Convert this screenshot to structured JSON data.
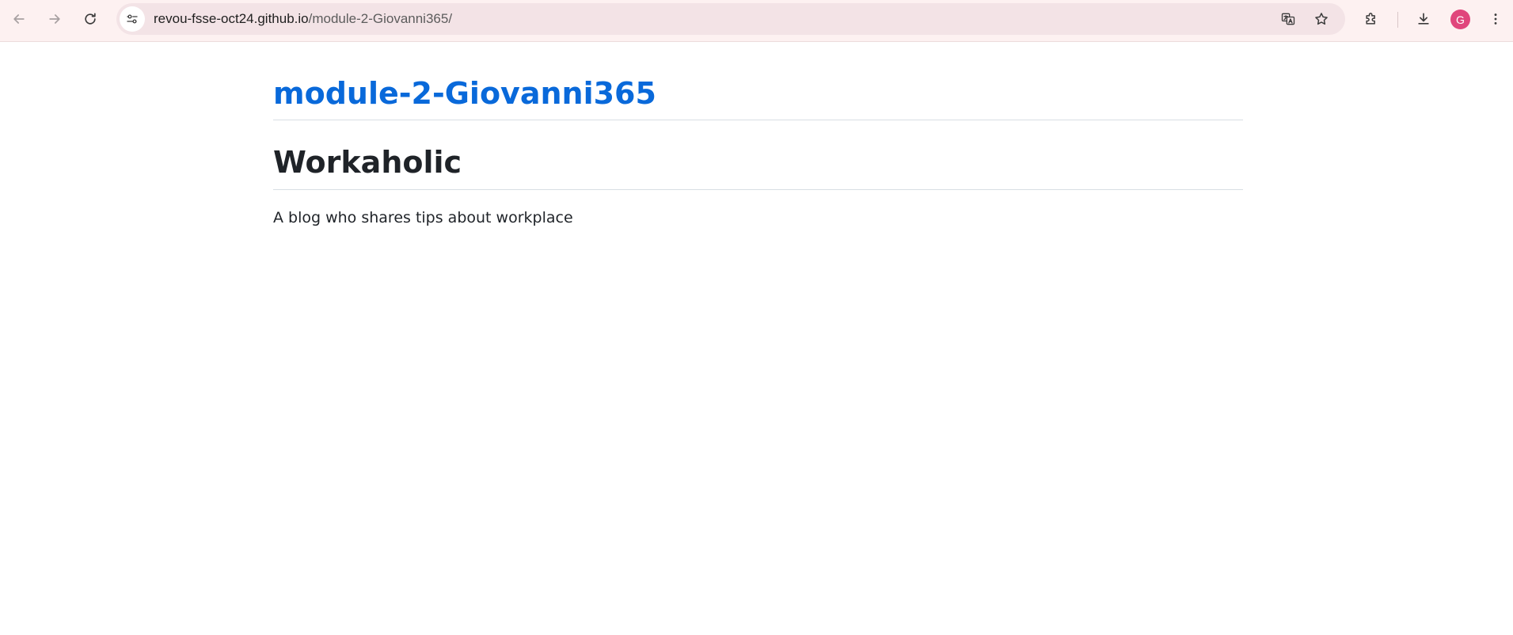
{
  "browser": {
    "url_host": "revou-fsse-oct24.github.io",
    "url_path": "/module-2-Giovanni365/",
    "profile_initial": "G",
    "icons": {
      "back": "arrow-left-icon",
      "forward": "arrow-right-icon",
      "reload": "reload-icon",
      "site_info": "tune-icon",
      "translate": "translate-icon",
      "bookmark": "star-icon",
      "extensions": "puzzle-icon",
      "downloads": "download-icon",
      "menu": "kebab-menu-icon"
    },
    "colors": {
      "toolbar_bg": "#fdf1f1",
      "omnibox_bg": "#f3e3e6",
      "avatar_bg": "#e0467c"
    }
  },
  "page": {
    "site_title": "module-2-Giovanni365",
    "heading": "Workaholic",
    "tagline": "A blog who shares tips about workplace",
    "colors": {
      "link": "#0969da",
      "text": "#1f2328"
    }
  }
}
